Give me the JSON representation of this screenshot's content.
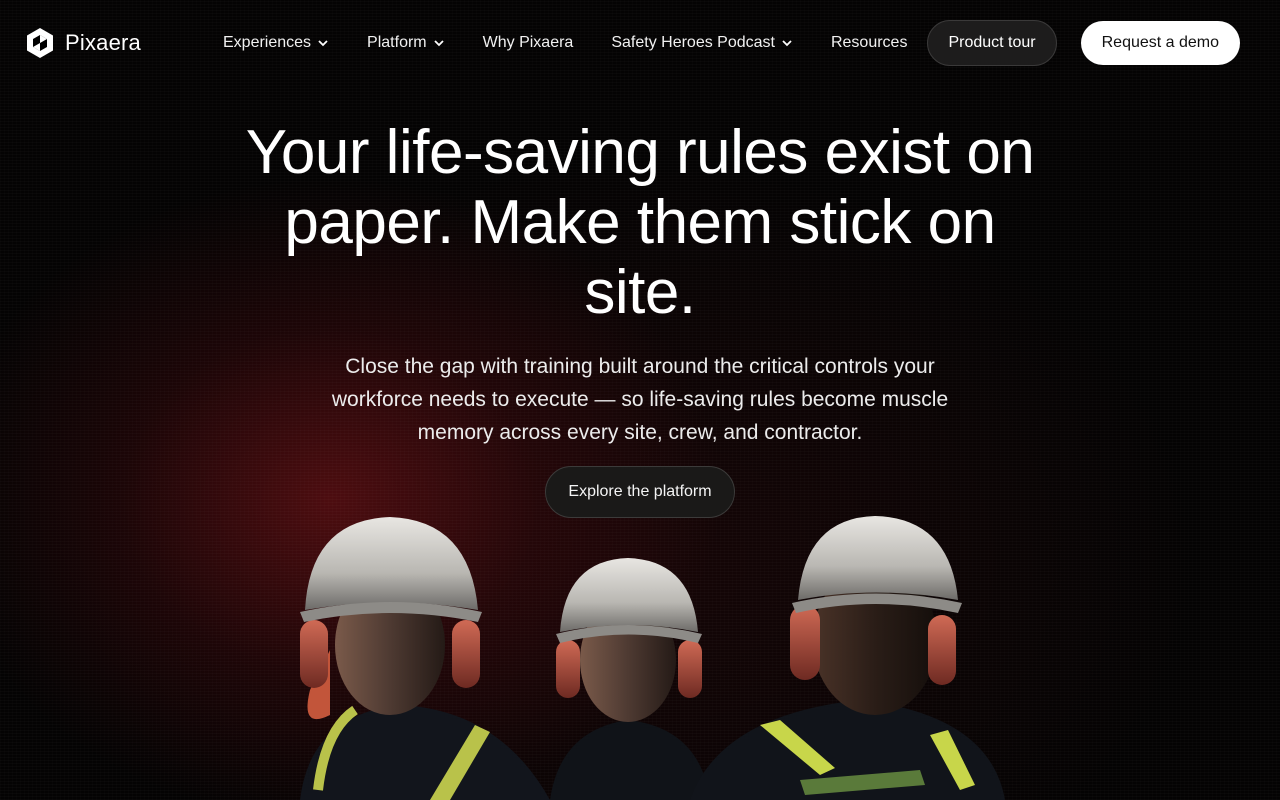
{
  "brand": {
    "name": "Pixaera",
    "logo_icon": "pixaera-logo-icon"
  },
  "nav": {
    "items": [
      {
        "label": "Experiences",
        "has_dropdown": true
      },
      {
        "label": "Platform",
        "has_dropdown": true
      },
      {
        "label": "Why Pixaera",
        "has_dropdown": false
      },
      {
        "label": "Safety Heroes Podcast",
        "has_dropdown": true
      },
      {
        "label": "Resources",
        "has_dropdown": false
      }
    ],
    "tour_label": "Product tour",
    "demo_label": "Request a demo"
  },
  "hero": {
    "headline": "Your life-saving rules exist on paper. Make them stick on site.",
    "subtext": "Close the gap with training built around the critical controls your workforce needs to execute — so life-saving rules become muscle memory across every site, crew, and contractor.",
    "cta_label": "Explore the platform"
  },
  "colors": {
    "background": "#000000",
    "accent_glow": "#821419",
    "button_dark": "#1d1c1c",
    "button_light": "#ffffff",
    "hi_vis": "#c8d64a"
  }
}
